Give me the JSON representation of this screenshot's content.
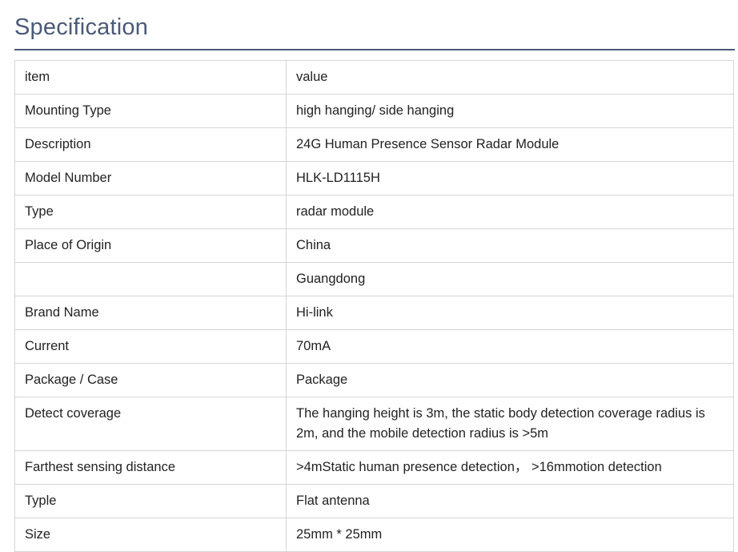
{
  "title": "Specification",
  "table": {
    "rows": [
      {
        "item": "item",
        "value": "value"
      },
      {
        "item": "Mounting Type",
        "value": "high hanging/ side hanging"
      },
      {
        "item": "Description",
        "value": "24G Human Presence Sensor Radar Module"
      },
      {
        "item": "Model Number",
        "value": "HLK-LD1115H"
      },
      {
        "item": "Type",
        "value": "radar module"
      },
      {
        "item": "Place of Origin",
        "value": "China"
      },
      {
        "item": "",
        "value": "Guangdong"
      },
      {
        "item": "Brand Name",
        "value": "Hi-link"
      },
      {
        "item": "Current",
        "value": "70mA"
      },
      {
        "item": "Package / Case",
        "value": "Package"
      },
      {
        "item": "Detect coverage",
        "value": "The hanging height is 3m, the static body detection coverage radius is 2m, and the mobile detection radius is >5m"
      },
      {
        "item": "Farthest sensing distance",
        "value": ">4mStatic human presence detection， >16mmotion detection"
      },
      {
        "item": "Typle",
        "value": "Flat antenna"
      },
      {
        "item": "Size",
        "value": "25mm * 25mm"
      }
    ]
  }
}
